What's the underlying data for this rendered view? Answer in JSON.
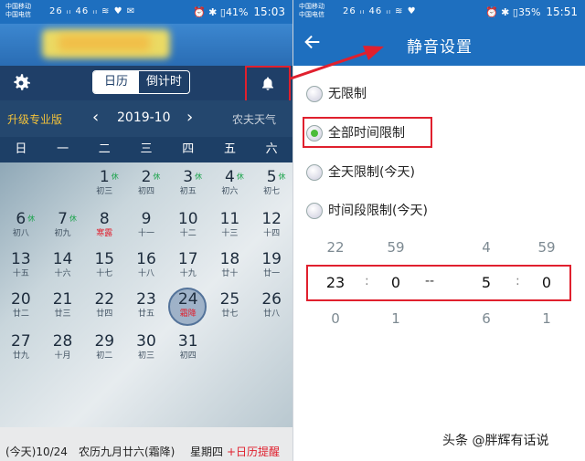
{
  "left": {
    "status": {
      "carrier1": "中国移动",
      "carrier2": "中国电信",
      "icons": "26 ᵢₗ 46 ᵢₗ ≋ ♥ ✉",
      "battery": "⏰ ✱ ▯41%",
      "time": "15:03"
    },
    "tabs": [
      "日历",
      "倒计时"
    ],
    "upgrade_label": "升级专业版",
    "month": "2019-10",
    "weather_label": "农夫天气",
    "weekdays": [
      "日",
      "一",
      "二",
      "三",
      "四",
      "五",
      "六"
    ],
    "days": [
      {
        "n": "1",
        "sup": "休",
        "l": "初三"
      },
      {
        "n": "2",
        "sup": "休",
        "l": "初四"
      },
      {
        "n": "3",
        "sup": "休",
        "l": "初五"
      },
      {
        "n": "4",
        "sup": "休",
        "l": "初六"
      },
      {
        "n": "5",
        "sup": "休",
        "l": "初七"
      },
      {
        "n": "6",
        "sup": "休",
        "l": "初八"
      },
      {
        "n": "7",
        "sup": "休",
        "l": "初九"
      },
      {
        "n": "8",
        "sup": "",
        "l": "寒露",
        "red": true
      },
      {
        "n": "9",
        "sup": "",
        "l": "十一"
      },
      {
        "n": "10",
        "sup": "",
        "l": "十二"
      },
      {
        "n": "11",
        "sup": "",
        "l": "十三"
      },
      {
        "n": "12",
        "sup": "",
        "l": "十四"
      },
      {
        "n": "13",
        "sup": "",
        "l": "十五"
      },
      {
        "n": "14",
        "sup": "",
        "l": "十六"
      },
      {
        "n": "15",
        "sup": "",
        "l": "十七"
      },
      {
        "n": "16",
        "sup": "",
        "l": "十八"
      },
      {
        "n": "17",
        "sup": "",
        "l": "十九"
      },
      {
        "n": "18",
        "sup": "",
        "l": "廿十"
      },
      {
        "n": "19",
        "sup": "",
        "l": "廿一"
      },
      {
        "n": "20",
        "sup": "",
        "l": "廿二"
      },
      {
        "n": "21",
        "sup": "",
        "l": "廿三"
      },
      {
        "n": "22",
        "sup": "",
        "l": "廿四"
      },
      {
        "n": "23",
        "sup": "",
        "l": "廿五"
      },
      {
        "n": "24",
        "sup": "",
        "l": "霜降",
        "red": true,
        "today": true
      },
      {
        "n": "25",
        "sup": "",
        "l": "廿七"
      },
      {
        "n": "26",
        "sup": "",
        "l": "廿八"
      },
      {
        "n": "27",
        "sup": "",
        "l": "廿九"
      },
      {
        "n": "28",
        "sup": "",
        "l": "十月"
      },
      {
        "n": "29",
        "sup": "",
        "l": "初二"
      },
      {
        "n": "30",
        "sup": "",
        "l": "初三"
      },
      {
        "n": "31",
        "sup": "",
        "l": "初四"
      }
    ],
    "bottom": {
      "today": "(今天)10/24",
      "lunar": "农历九月廿六(霜降)",
      "weekday": "星期四",
      "remind": "+日历提醒"
    }
  },
  "right": {
    "status": {
      "carrier1": "中国移动",
      "carrier2": "中国电信",
      "icons": "26 ᵢₗ 46 ᵢₗ ≋ ♥",
      "battery": "⏰ ✱ ▯35%",
      "time": "15:51"
    },
    "title": "静音设置",
    "options": [
      "无限制",
      "全部时间限制",
      "全天限制(今天)",
      "时间段限制(今天)"
    ],
    "picker": {
      "top": [
        "22",
        "59",
        "4",
        "59"
      ],
      "selected": [
        "23",
        "0",
        "5",
        "0"
      ],
      "bottom": [
        "0",
        "1",
        "6",
        "1"
      ],
      "colon": ":",
      "dash": "--"
    }
  },
  "watermark": "头条 @胖辉有话说"
}
